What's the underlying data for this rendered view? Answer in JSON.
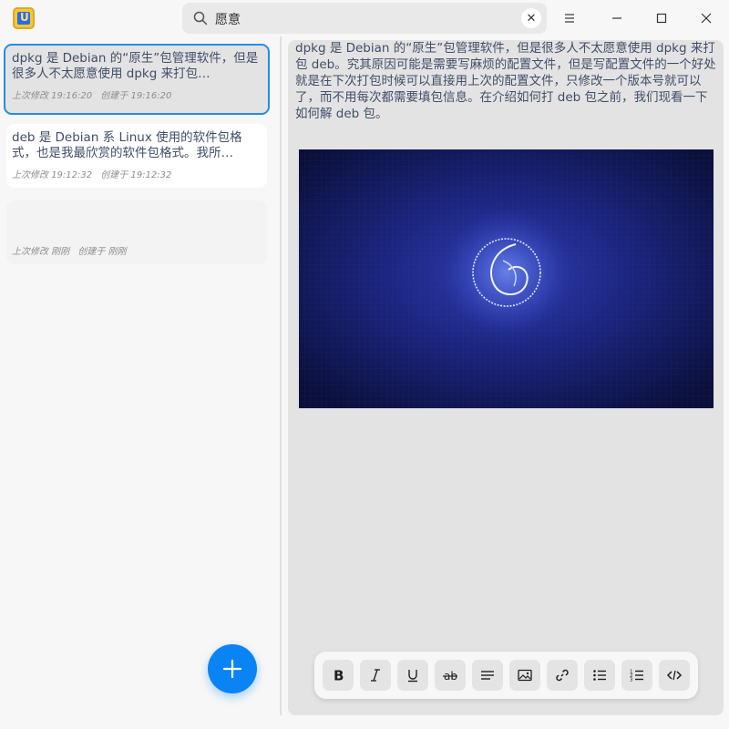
{
  "app": {
    "icon": "notes-app-icon",
    "icon_letter": "U"
  },
  "search": {
    "value": "愿意",
    "icon": "search-icon",
    "clear_icon": "clear-icon"
  },
  "window": {
    "menu_icon": "menu-icon",
    "minimize_icon": "minimize-icon",
    "maximize_icon": "maximize-icon",
    "close_icon": "close-icon"
  },
  "notes": [
    {
      "title": "dpkg 是 Debian 的“原生”包管理软件，但是很多人不太愿意使用 dpkg 来打包…",
      "modified": "上次修改 19:16:20",
      "created": "创建于 19:16:20"
    },
    {
      "title": "deb 是 Debian 系 Linux 使用的软件包格式，也是我最欣赏的软件包格式。我所…",
      "modified": "上次修改 19:12:32",
      "created": "创建于 19:12:32"
    },
    {
      "title": "",
      "modified": "上次修改 刚刚",
      "created": "创建于 刚刚"
    }
  ],
  "editor": {
    "text": "dpkg 是 Debian 的“原生”包管理软件，但是很多人不太愿意使用 dpkg 来打包 deb。究其原因可能是需要写麻烦的配置文件，但是写配置文件的一个好处就是在下次打包时候可以直接用上次的配置文件，只修改一个版本号就可以了，而不用每次都需要填包信息。在介绍如何打 deb 包之前，我们现看一下如何解 deb 包。",
    "image": "deepin-logo-wallpaper"
  },
  "colors": {
    "accent": "#0a84f5",
    "selection_border": "#2a8bdf",
    "text": "#414d68"
  },
  "toolbar": [
    "bold-icon",
    "italic-icon",
    "underline-icon",
    "strikethrough-icon",
    "divider-line-icon",
    "insert-image-icon",
    "link-icon",
    "bulleted-list-icon",
    "numbered-list-icon",
    "code-icon"
  ],
  "add_button": {
    "icon": "plus-icon"
  }
}
